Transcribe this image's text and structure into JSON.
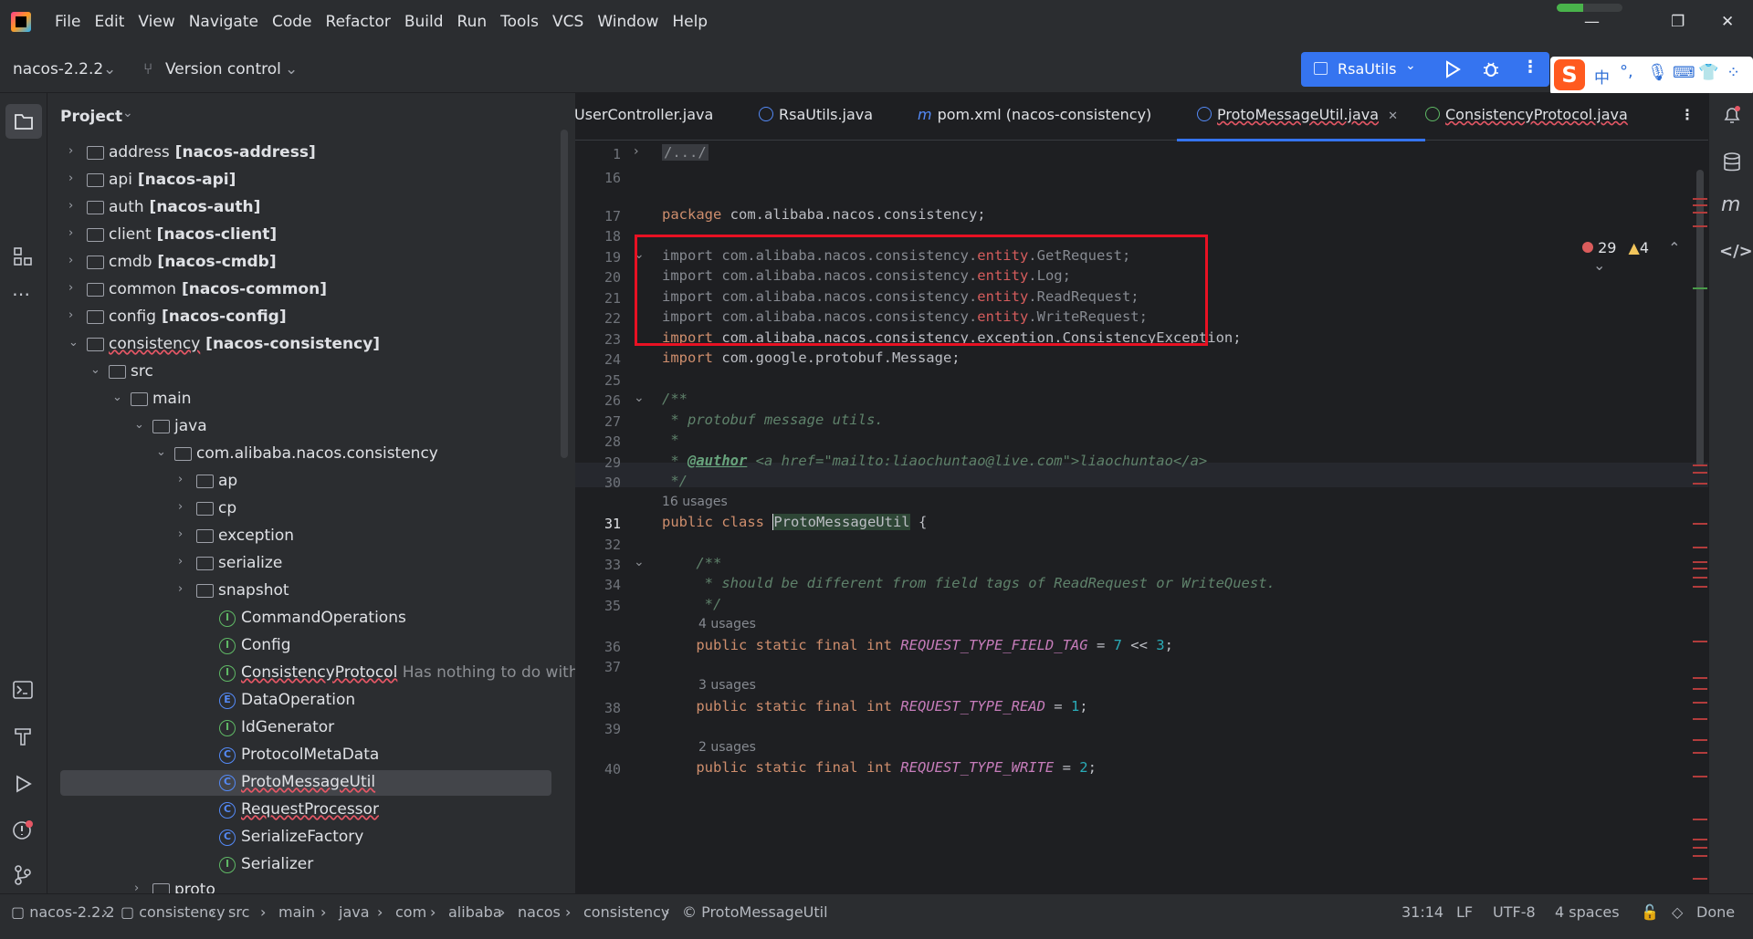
{
  "menu": [
    "File",
    "Edit",
    "View",
    "Navigate",
    "Code",
    "Refactor",
    "Build",
    "Run",
    "Tools",
    "VCS",
    "Window",
    "Help"
  ],
  "window": {
    "minimize": "—",
    "restore": "❐",
    "close": "✕"
  },
  "toolbar": {
    "project": "nacos-2.2.2",
    "vcs": "Version control",
    "run_config": "RsaUtils"
  },
  "ime": {
    "label": "中"
  },
  "project_panel": {
    "title": "Project"
  },
  "tree": [
    {
      "label": "address",
      "module": "[nacos-address]"
    },
    {
      "label": "api",
      "module": "[nacos-api]"
    },
    {
      "label": "auth",
      "module": "[nacos-auth]"
    },
    {
      "label": "client",
      "module": "[nacos-client]"
    },
    {
      "label": "cmdb",
      "module": "[nacos-cmdb]"
    },
    {
      "label": "common",
      "module": "[nacos-common]"
    },
    {
      "label": "config",
      "module": "[nacos-config]"
    },
    {
      "label": "consistency",
      "module": "[nacos-consistency]"
    },
    {
      "label": "src"
    },
    {
      "label": "main"
    },
    {
      "label": "java"
    },
    {
      "label": "com.alibaba.nacos.consistency"
    },
    {
      "label": "ap"
    },
    {
      "label": "cp"
    },
    {
      "label": "exception"
    },
    {
      "label": "serialize"
    },
    {
      "label": "snapshot"
    },
    {
      "label": "CommandOperations"
    },
    {
      "label": "Config"
    },
    {
      "label": "ConsistencyProtocol",
      "hint": "Has nothing to do with the"
    },
    {
      "label": "DataOperation"
    },
    {
      "label": "IdGenerator"
    },
    {
      "label": "ProtocolMetaData"
    },
    {
      "label": "ProtoMessageUtil"
    },
    {
      "label": "RequestProcessor"
    },
    {
      "label": "SerializeFactory"
    },
    {
      "label": "Serializer"
    },
    {
      "label": "proto"
    }
  ],
  "tabs": [
    "UserController.java",
    "RsaUtils.java",
    "pom.xml (nacos-consistency)",
    "ProtoMessageUtil.java",
    "ConsistencyProtocol.java"
  ],
  "inspections": {
    "errors": "29",
    "warnings": "4"
  },
  "line_numbers": [
    "1",
    "16",
    "17",
    "18",
    "19",
    "20",
    "21",
    "22",
    "23",
    "24",
    "25",
    "26",
    "27",
    "28",
    "29",
    "30",
    "31",
    "32",
    "33",
    "34",
    "35",
    "36",
    "37",
    "38",
    "39",
    "40"
  ],
  "usages": {
    "class": "16 usages",
    "field1": "4 usages",
    "field2": "3 usages",
    "field3": "2 usages"
  },
  "code": {
    "l1": "/.../",
    "pkg_kw": "package",
    "pkg": " com.alibaba.nacos.consistency;",
    "imp": "import",
    "imp_pre": " com.alibaba.nacos.consistency.",
    "entity": "entity",
    "i19": ".GetRequest;",
    "i20": ".Log;",
    "i21": ".ReadRequest;",
    "i22": ".WriteRequest;",
    "i23": " com.alibaba.nacos.consistency.exception.ConsistencyException;",
    "i24": " com.google.protobuf.Message;",
    "d26": "/**",
    "d27": " * protobuf message utils.",
    "d28": " *",
    "d29a": " * ",
    "d29tag": "@author",
    "d29b": " <a href=\"mailto:liaochuntao@live.com\">liaochuntao</a>",
    "d30": " */",
    "c31a": "public class ",
    "c31b": "ProtoMessageUtil",
    " c31c": " {",
    "d33": "    /**",
    "d34": "     * should be different from field tags of ReadRequest or WriteQuest.",
    "d35": "     */",
    "mods": "    public static final int ",
    "f36": "REQUEST_TYPE_FIELD_TAG",
    "f36v": "7",
    "f36op": " << ",
    "f36v2": "3",
    "f38": "REQUEST_TYPE_READ",
    "f38v": "1",
    "f40": "REQUEST_TYPE_WRITE",
    "f40v": "2",
    "eq": " = ",
    "semi": ";"
  },
  "status": {
    "crumbs": [
      "nacos-2.2.2",
      "consistency",
      "src",
      "main",
      "java",
      "com",
      "alibaba",
      "nacos",
      "consistency",
      "ProtoMessageUtil"
    ],
    "pos": "31:14",
    "le": "LF",
    "enc": "UTF-8",
    "indent": "4 spaces",
    "done": "Done"
  }
}
